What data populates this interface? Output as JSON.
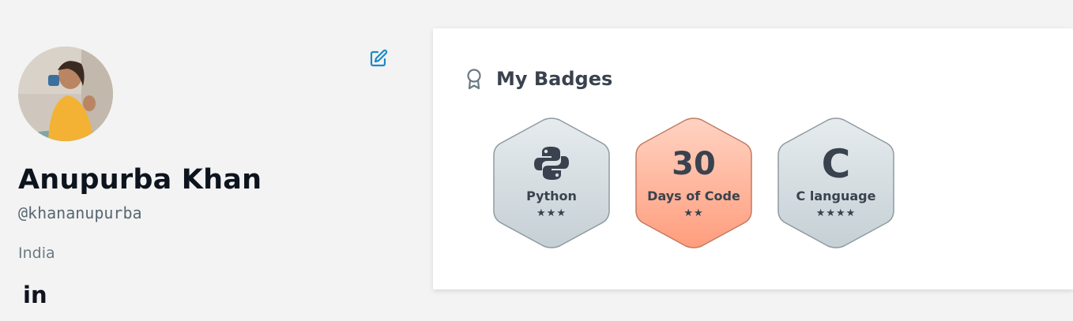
{
  "profile": {
    "name": "Anupurba Khan",
    "handle": "@khananupurba",
    "country": "India",
    "social_link_label": "in"
  },
  "badges_section": {
    "title": "My Badges",
    "badges": [
      {
        "label": "Python",
        "stars": "★★★",
        "icon": "python-logo-icon",
        "theme": "silver"
      },
      {
        "label": "Days of Code",
        "value": "30",
        "stars": "★★",
        "theme": "bronze"
      },
      {
        "label": "C language",
        "value": "C",
        "stars": "★★★★",
        "theme": "silver"
      }
    ]
  },
  "colors": {
    "silver_fill_top": "#e4e9ec",
    "silver_fill_bottom": "#c7d2d7",
    "bronze_fill_top": "#ffcfbd",
    "bronze_fill_bottom": "#ff9f80",
    "edit_icon": "#1d8ac7",
    "text_dark": "#39424e"
  }
}
